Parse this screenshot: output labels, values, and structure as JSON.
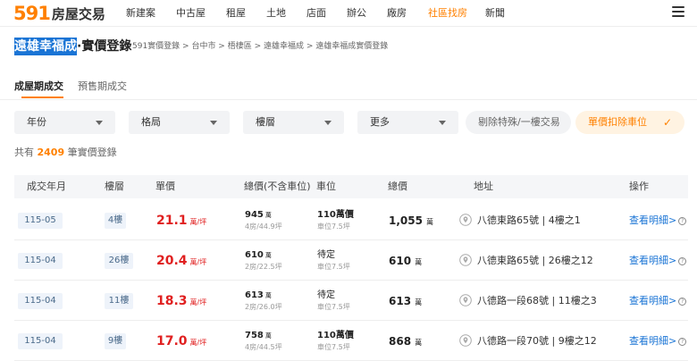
{
  "logo": {
    "num": "591",
    "text": "房屋交易"
  },
  "nav": [
    "新建案",
    "中古屋",
    "租屋",
    "土地",
    "店面",
    "辦公",
    "廠房",
    "社區找房",
    "新聞"
  ],
  "title": {
    "highlight": "遠雄幸福成",
    "rest": "·實價登錄"
  },
  "breadcrumb": "591實價登錄 > 台中市 > 梧棲區 > 遠雄幸福成 > 遠雄幸福成實價登錄",
  "tabs": [
    "成屋期成交",
    "預售期成交"
  ],
  "filters": [
    "年份",
    "格局",
    "樓層",
    "更多"
  ],
  "pills": {
    "exclude": "剔除特殊/一樓交易",
    "unit_price": "單價扣除車位",
    "check": "✓"
  },
  "count": {
    "prefix": "共有",
    "value": "2409",
    "suffix": "筆實價登錄"
  },
  "headers": [
    "成交年月",
    "樓層",
    "單價",
    "總價(不含車位)",
    "車位",
    "總價",
    "地址",
    "操作"
  ],
  "units": {
    "unit_price": "萬/坪",
    "wan": "萬",
    "price_tag": "價"
  },
  "rows": [
    {
      "date": "115-05",
      "floor": "4樓",
      "unit_price": "21.1",
      "net_price": "945",
      "layout": "4房/44.9坪",
      "parking_main": "110",
      "parking_tag": true,
      "parking_sub": "車位7.5坪",
      "total": "1,055",
      "address": "八德東路65號 | 4樓之1",
      "action": "查看明細>"
    },
    {
      "date": "115-04",
      "floor": "26樓",
      "unit_price": "20.4",
      "net_price": "610",
      "layout": "2房/22.5坪",
      "parking_main": "待定",
      "parking_tag": false,
      "parking_sub": "車位7.5坪",
      "total": "610",
      "address": "八德東路65號 | 26樓之12",
      "action": "查看明細>"
    },
    {
      "date": "115-04",
      "floor": "11樓",
      "unit_price": "18.3",
      "net_price": "613",
      "layout": "2房/26.0坪",
      "parking_main": "待定",
      "parking_tag": false,
      "parking_sub": "車位7.5坪",
      "total": "613",
      "address": "八德路一段68號 | 11樓之3",
      "action": "查看明細>"
    },
    {
      "date": "115-04",
      "floor": "9樓",
      "unit_price": "17.0",
      "net_price": "758",
      "layout": "4房/44.5坪",
      "parking_main": "110",
      "parking_tag": true,
      "parking_sub": "車位7.5坪",
      "total": "868",
      "address": "八德路一段70號 | 9樓之12",
      "action": "查看明細>"
    }
  ]
}
